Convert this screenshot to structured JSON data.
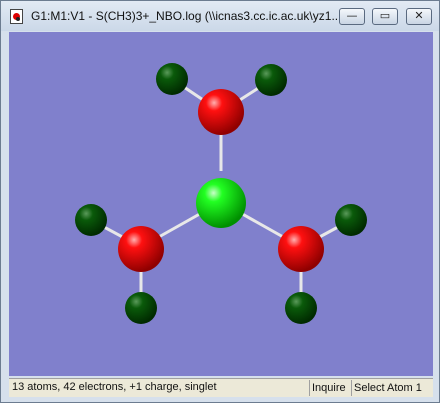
{
  "window": {
    "title": "G1:M1:V1 - S(CH3)3+_NBO.log (\\\\icnas3.cc.ic.ac.uk\\yz1...",
    "minimize_label": "—",
    "maximize_label": "▭",
    "close_label": "✕"
  },
  "colors": {
    "background": "#8080cc",
    "sulfur": "#00e000",
    "carbon": "#ee0000",
    "hydrogen": "#0a4a0a",
    "bond": "#e8e8e8"
  },
  "molecule": {
    "central_atom": "S",
    "groups": [
      "CH3",
      "CH3",
      "CH3"
    ]
  },
  "statusbar": {
    "info": "13 atoms, 42 electrons, +1 charge, singlet",
    "mode": "Inquire",
    "action": "Select Atom 1"
  }
}
